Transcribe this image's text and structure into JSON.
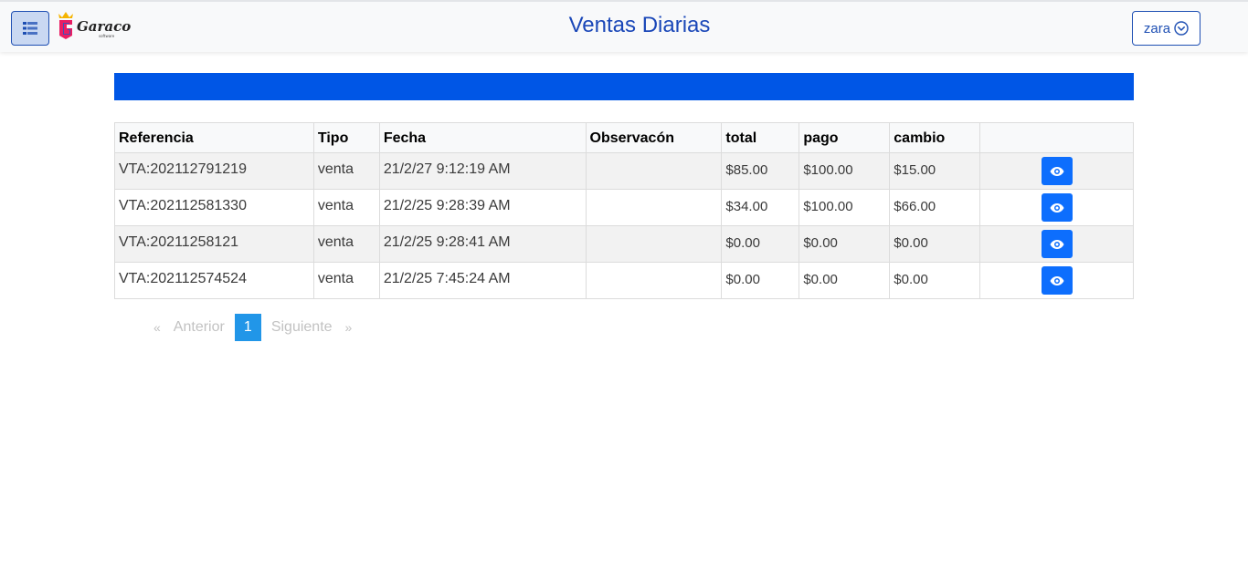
{
  "header": {
    "title": "Ventas Diarias",
    "user_label": "zara",
    "logo_text": "Garaco"
  },
  "table": {
    "columns": [
      "Referencia",
      "Tipo",
      "Fecha",
      "Observacón",
      "total",
      "pago",
      "cambio",
      ""
    ],
    "rows": [
      {
        "ref": "VTA:202112791219",
        "tipo": "venta",
        "fecha": "21/2/27 9:12:19 AM",
        "obs": "",
        "total": "$85.00",
        "pago": "$100.00",
        "cambio": "$15.00"
      },
      {
        "ref": "VTA:202112581330",
        "tipo": "venta",
        "fecha": "21/2/25 9:28:39 AM",
        "obs": "",
        "total": "$34.00",
        "pago": "$100.00",
        "cambio": "$66.00"
      },
      {
        "ref": "VTA:20211258121",
        "tipo": "venta",
        "fecha": "21/2/25 9:28:41 AM",
        "obs": "",
        "total": "$0.00",
        "pago": "$0.00",
        "cambio": "$0.00"
      },
      {
        "ref": "VTA:202112574524",
        "tipo": "venta",
        "fecha": "21/2/25 7:45:24 AM",
        "obs": "",
        "total": "$0.00",
        "pago": "$0.00",
        "cambio": "$0.00"
      }
    ]
  },
  "pagination": {
    "prev_arrow": "«",
    "prev_label": "Anterior",
    "current_page": "1",
    "next_label": "Siguiente",
    "next_arrow": "»"
  },
  "icons": {
    "menu": "list-icon",
    "user_dropdown": "chevron-circle-down-icon",
    "view": "eye-icon"
  },
  "colors": {
    "accent": "#0d6efd",
    "banner": "#0056e6",
    "title": "#1a47b8",
    "pagination_active": "#2196e8"
  }
}
